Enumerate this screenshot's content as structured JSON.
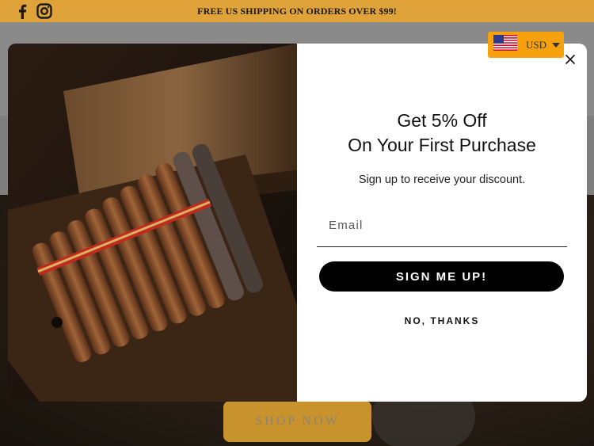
{
  "announcement": {
    "text": "FREE US SHIPPING ON ORDERS OVER $99!",
    "icons": [
      "facebook-icon",
      "instagram-icon"
    ],
    "background": "#e0a33a"
  },
  "currency": {
    "code": "USD",
    "flag": "us-flag-icon",
    "background": "#f7a10e"
  },
  "hero": {
    "cta_label": "SHOP NOW",
    "cta_color": "#c8922c"
  },
  "modal": {
    "image": "cigars-in-wooden-box",
    "title_line1": "Get 5% Off",
    "title_line2": "On Your First Purchase",
    "subtitle": "Sign up to receive your discount.",
    "email_placeholder": "Email",
    "email_value": "",
    "submit_label": "SIGN ME UP!",
    "decline_label": "NO, THANKS",
    "close_icon": "close-icon"
  }
}
